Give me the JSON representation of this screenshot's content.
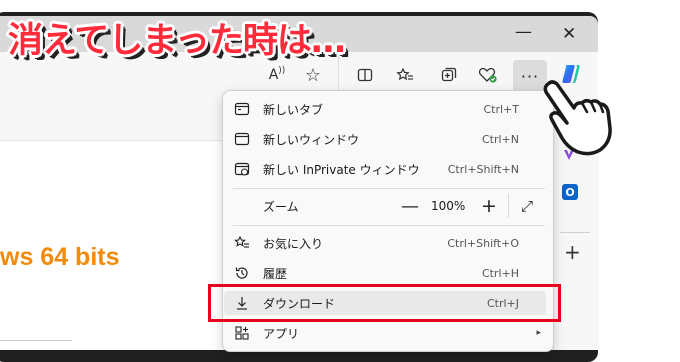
{
  "headline": "消えてしまった時は…",
  "window": {
    "minimize": "—",
    "close": "✕"
  },
  "toolbar": {
    "read_aloud": "A",
    "more_label": "···",
    "icons": [
      "read-aloud-icon",
      "favorite-star-icon",
      "split-screen-icon",
      "favorites-icon",
      "collections-icon",
      "browser-essentials-icon",
      "more-icon",
      "copilot-icon"
    ]
  },
  "content": {
    "text": "ws 64 bits"
  },
  "sidebar": {
    "outlook_letter": "O",
    "add": "+"
  },
  "menu": {
    "items": [
      {
        "label": "新しいタブ",
        "shortcut": "Ctrl+T"
      },
      {
        "label": "新しいウィンドウ",
        "shortcut": "Ctrl+N"
      },
      {
        "label": "新しい InPrivate ウィンドウ",
        "shortcut": "Ctrl+Shift+N"
      },
      {
        "label": "ズーム",
        "zoom_minus": "—",
        "zoom_value": "100%",
        "zoom_plus": "+",
        "fullscreen": "⤢"
      },
      {
        "label": "お気に入り",
        "shortcut": "Ctrl+Shift+O"
      },
      {
        "label": "履歴",
        "shortcut": "Ctrl+H"
      },
      {
        "label": "ダウンロード",
        "shortcut": "Ctrl+J"
      },
      {
        "label": "アプリ",
        "chevron": "▸"
      }
    ]
  },
  "colors": {
    "headline": "#ff2a3a",
    "highlight": "#e8001e",
    "content_text": "#f28a0c"
  }
}
